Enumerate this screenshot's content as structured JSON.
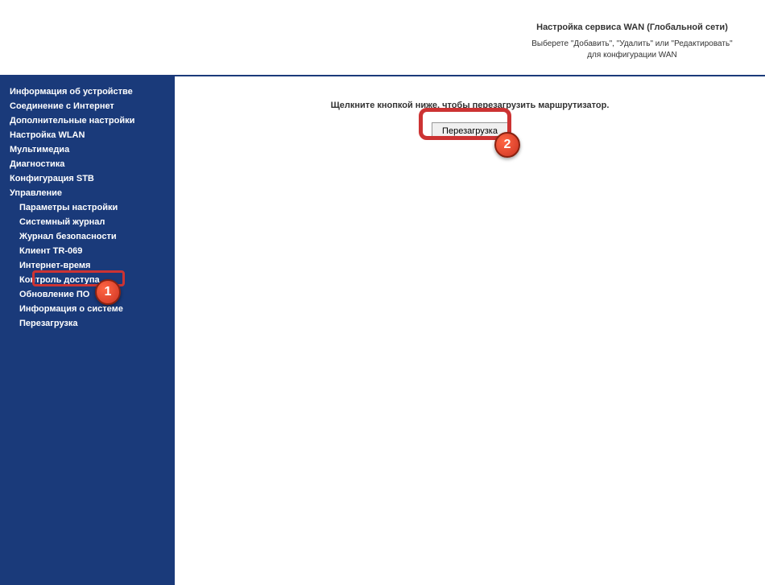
{
  "header": {
    "title": "Настройка сервиса WAN (Глобальной сети)",
    "subtitle": "Выберете \"Добавить\", \"Удалить\" или \"Редактировать\" для конфигурации WAN"
  },
  "sidebar": {
    "items": [
      {
        "label": "Информация об устройстве",
        "type": "main"
      },
      {
        "label": "Соединение с Интернет",
        "type": "main"
      },
      {
        "label": "Дополнительные настройки",
        "type": "main"
      },
      {
        "label": "Настройка WLAN",
        "type": "main"
      },
      {
        "label": "Мультимедиа",
        "type": "main"
      },
      {
        "label": "Диагностика",
        "type": "main"
      },
      {
        "label": "Конфигурация STB",
        "type": "main"
      },
      {
        "label": "Управление",
        "type": "main"
      },
      {
        "label": "Параметры настройки",
        "type": "sub"
      },
      {
        "label": "Системный журнал",
        "type": "sub"
      },
      {
        "label": "Журнал безопасности",
        "type": "sub"
      },
      {
        "label": "Клиент TR-069",
        "type": "sub"
      },
      {
        "label": "Интернет-время",
        "type": "sub"
      },
      {
        "label": "Контроль доступа",
        "type": "sub"
      },
      {
        "label": "Обновление ПО",
        "type": "sub"
      },
      {
        "label": "Информация о системе",
        "type": "sub"
      },
      {
        "label": "Перезагрузка",
        "type": "sub"
      }
    ]
  },
  "content": {
    "instruction": "Щелкните кнопкой ниже, чтобы перезагрузить маршрутизатор.",
    "button_label": "Перезагрузка"
  },
  "annotations": {
    "marker1": "1",
    "marker2": "2"
  }
}
